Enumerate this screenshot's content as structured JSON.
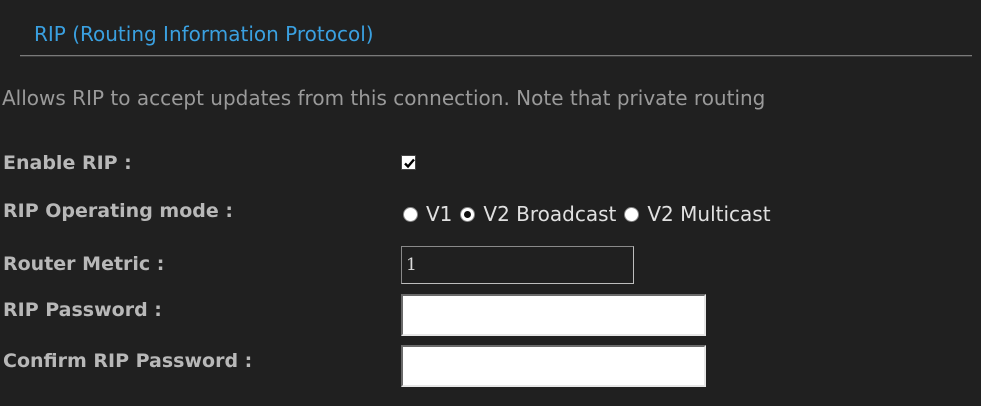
{
  "section": {
    "title": "RIP (Routing Information Protocol)",
    "description": "Allows RIP to accept updates from this connection. Note that private routing"
  },
  "fields": {
    "enable_rip": {
      "label": "Enable RIP :",
      "checked": true
    },
    "operating_mode": {
      "label": "RIP Operating mode :",
      "options": [
        "V1",
        "V2 Broadcast",
        "V2 Multicast"
      ],
      "selected": "V2 Broadcast"
    },
    "router_metric": {
      "label": "Router Metric :",
      "value": "1"
    },
    "rip_password": {
      "label": "RIP Password :",
      "value": ""
    },
    "confirm_password": {
      "label": "Confirm RIP Password :",
      "value": ""
    }
  },
  "colors": {
    "background": "#202020",
    "title": "#3aa0e0",
    "label": "#b8b8b8",
    "description": "#9a9a9a"
  }
}
